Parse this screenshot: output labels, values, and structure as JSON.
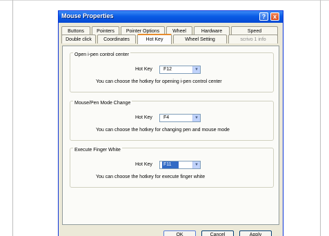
{
  "window": {
    "title": "Mouse Properties",
    "help_label": "?",
    "close_label": "x"
  },
  "tabs": {
    "row1": [
      "Buttons",
      "Pointers",
      "Pointer Options",
      "Wheel",
      "Hardware",
      "Speed"
    ],
    "row2": [
      "Double click",
      "Coordinates",
      "Hot Key",
      "Wheel Setting",
      "scrivo 1 info"
    ],
    "active": "Hot Key"
  },
  "groups": [
    {
      "title": "Open i-pen control center",
      "hotkey_label": "Hot Key",
      "hotkey_value": "F12",
      "description": "You can choose the hotkey for opening i-pen control center"
    },
    {
      "title": "Mouse/Pen Mode Change",
      "hotkey_label": "Hot Key",
      "hotkey_value": "F4",
      "description": "You can choose the hotkey for changing pen and mouse mode"
    },
    {
      "title": "Execute Finger White",
      "hotkey_label": "Hot Key",
      "hotkey_value": "F11",
      "description": "You can choose the hotkey for  execute finger white"
    }
  ],
  "buttons": {
    "ok": "OK",
    "cancel": "Cancel",
    "apply": "Apply"
  }
}
